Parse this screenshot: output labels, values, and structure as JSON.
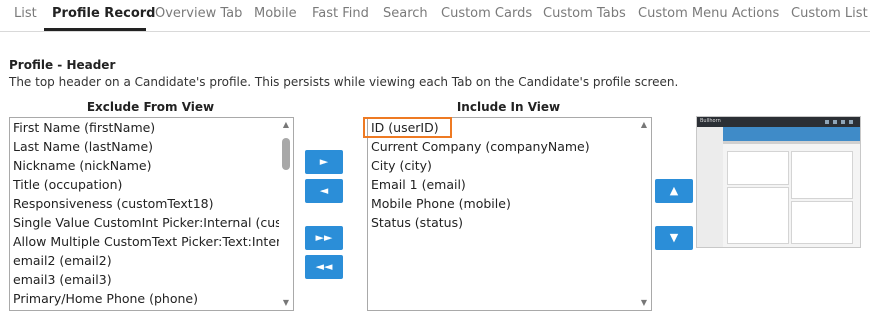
{
  "tabs": [
    "List",
    "Profile Record",
    "Overview Tab",
    "Mobile",
    "Fast Find",
    "Search",
    "Custom Cards",
    "Custom Tabs",
    "Custom Menu Actions",
    "Custom List I"
  ],
  "active_tab": "Profile Record",
  "section": {
    "title": "Profile - Header",
    "description": "The top header on a Candidate's profile. This persists while viewing each Tab on the Candidate's profile screen."
  },
  "exclude": {
    "heading": "Exclude From View",
    "items": [
      "First Name (firstName)",
      "Last Name (lastName)",
      "Nickname (nickName)",
      "Title (occupation)",
      "Responsiveness (customText18)",
      "Single Value CustomInt Picker:Internal (customInt",
      "Allow Multiple CustomText Picker:Text:Internal (cu",
      "email2 (email2)",
      "email3 (email3)",
      "Primary/Home Phone (phone)"
    ]
  },
  "include": {
    "heading": "Include In View",
    "items": [
      "ID (userID)",
      "Current Company (companyName)",
      "City (city)",
      "Email 1 (email)",
      "Mobile Phone (mobile)",
      "Status (status)"
    ]
  },
  "buttons": {
    "move_right": "►",
    "move_left": "◄",
    "move_all_right": "►►",
    "move_all_left": "◄◄",
    "move_up": "▲",
    "move_down": "▼"
  },
  "scroll_arrows": {
    "up": "▲",
    "down": "▼"
  },
  "preview": {
    "logo": "Bullhorn"
  },
  "colors": {
    "button": "#2b8ed8",
    "highlight": "#ee7a23",
    "active_tab": "#222222"
  }
}
